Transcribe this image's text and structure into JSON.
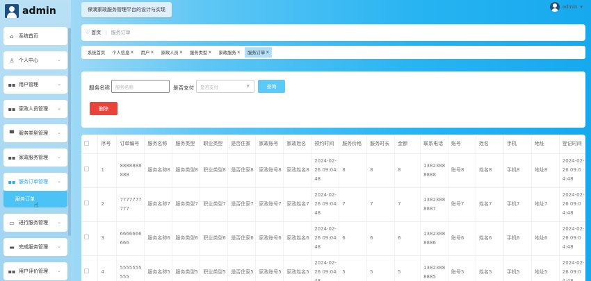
{
  "app": {
    "logo_text": "admin",
    "system_title": "保滴家政服务管理平台的设计与实现",
    "username": "admin"
  },
  "sidebar": {
    "items": [
      {
        "label": "系统首页",
        "icon": "home-icon",
        "glyph": "⌂",
        "expandable": false
      },
      {
        "label": "个人中心",
        "icon": "user-icon",
        "glyph": "♙",
        "expandable": true
      },
      {
        "label": "用户管理",
        "icon": "grid-icon",
        "glyph": "▪▪",
        "expandable": true
      },
      {
        "label": "家政人员管理",
        "icon": "grid-icon",
        "glyph": "▪▪",
        "expandable": true
      },
      {
        "label": "服务类型管理",
        "icon": "stamp-icon",
        "glyph": "▀",
        "expandable": true
      },
      {
        "label": "家政服务管理",
        "icon": "grid-icon",
        "glyph": "▪▪",
        "expandable": true
      },
      {
        "label": "服务订单管理",
        "icon": "grid-icon",
        "glyph": "▪▪",
        "expandable": true,
        "active": true,
        "sub": [
          "服务订单"
        ]
      },
      {
        "label": "进行服务管理",
        "icon": "computer-icon",
        "glyph": "▭",
        "expandable": true
      },
      {
        "label": "完成服务管理",
        "icon": "box-icon",
        "glyph": "▬",
        "expandable": true
      },
      {
        "label": "用户评价管理",
        "icon": "grid-icon",
        "glyph": "▪▪",
        "expandable": true
      }
    ]
  },
  "breadcrumb": {
    "home": "首页",
    "current": "服务订单"
  },
  "tags": [
    {
      "label": "系统首页",
      "closable": false
    },
    {
      "label": "个人信息",
      "closable": true
    },
    {
      "label": "用户",
      "closable": true
    },
    {
      "label": "家政人员",
      "closable": true
    },
    {
      "label": "服务类型",
      "closable": true
    },
    {
      "label": "家政服务",
      "closable": true
    },
    {
      "label": "服务订单",
      "closable": true,
      "active": true
    }
  ],
  "search": {
    "service_name_label": "服务名称",
    "service_name_placeholder": "服务名称",
    "paid_label": "是否支付",
    "paid_placeholder": "是否支付",
    "query_button": "查询",
    "delete_button": "删除"
  },
  "table": {
    "headers": [
      "序号",
      "订单编号",
      "服务名称",
      "服务类型",
      "职业类型",
      "是否住家",
      "家政账号",
      "家政姓名",
      "预约时间",
      "服务价格",
      "服务时长",
      "金额",
      "联系电话",
      "账号",
      "姓名",
      "手机",
      "地址",
      "登记时间"
    ],
    "rows": [
      [
        "1",
        "8888888888",
        "服务名称8",
        "服务类型8",
        "职业类型8",
        "是否住家8",
        "家政账号8",
        "家政姓名8",
        "2024-02-26 09:04:48",
        "8",
        "8",
        "8",
        "13823888888",
        "账号8",
        "姓名8",
        "手机8",
        "地址8",
        "2024-02-26 09:04:48"
      ],
      [
        "2",
        "7777777777",
        "服务名称7",
        "服务类型7",
        "职业类型7",
        "是否住家7",
        "家政账号7",
        "家政姓名7",
        "2024-02-26 09:04:48",
        "7",
        "7",
        "7",
        "13823888887",
        "账号7",
        "姓名7",
        "手机7",
        "地址7",
        "2024-02-26 09:04:48"
      ],
      [
        "3",
        "6666666666",
        "服务名称6",
        "服务类型6",
        "职业类型6",
        "是否住家6",
        "家政账号6",
        "家政姓名6",
        "2024-02-26 09:04:48",
        "6",
        "6",
        "6",
        "13823888886",
        "账号6",
        "姓名6",
        "手机6",
        "地址6",
        "2024-02-26 09:04:48"
      ],
      [
        "4",
        "5555555555",
        "服务名称5",
        "服务类型5",
        "职业类型5",
        "是否住家5",
        "家政账号5",
        "家政姓名5",
        "2024-02-26 09:04:48",
        "5",
        "5",
        "5",
        "13823888885",
        "账号5",
        "姓名5",
        "手机5",
        "地址5",
        "2024-02-26 09:04:48"
      ]
    ]
  }
}
